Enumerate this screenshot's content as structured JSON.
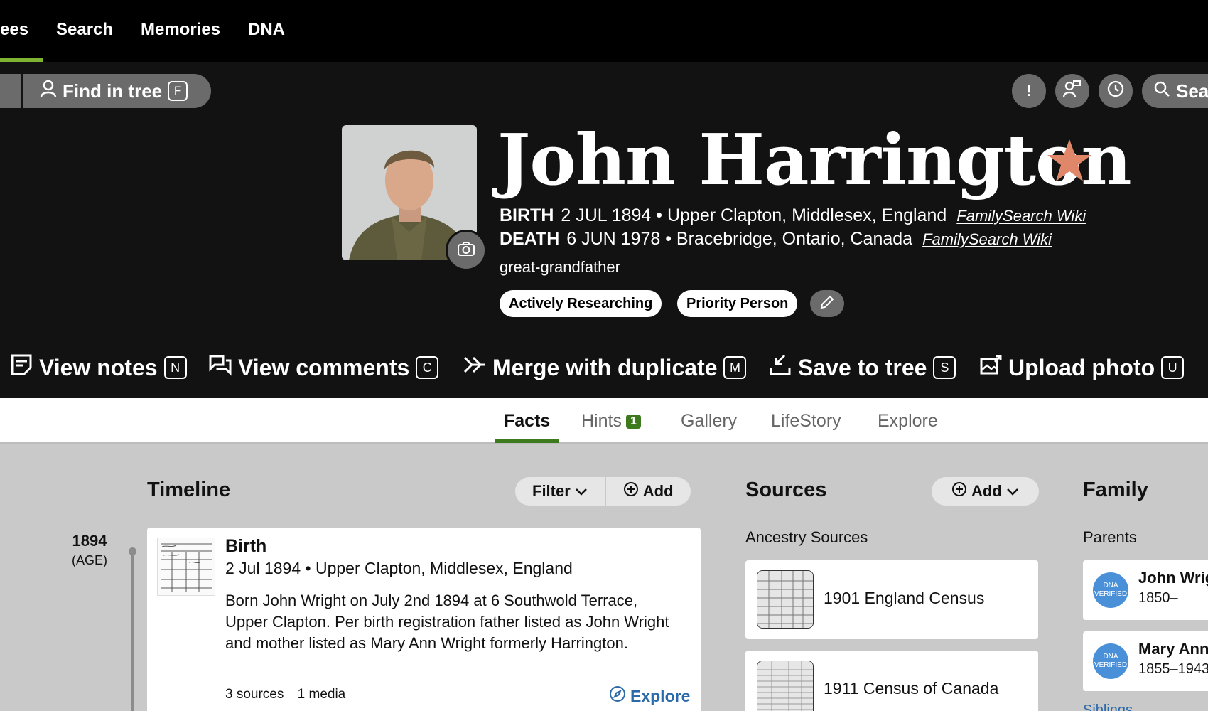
{
  "nav": {
    "items": [
      "ees",
      "Search",
      "Memories",
      "DNA"
    ]
  },
  "toolbar": {
    "find_in_tree": "Find in tree",
    "find_key": "F",
    "alert_icon": "!",
    "search_label": "Sea"
  },
  "person": {
    "name": "John Harrington",
    "birth_label": "BIRTH",
    "birth_value": "2 JUL 1894 • Upper Clapton, Middlesex, England",
    "death_label": "DEATH",
    "death_value": "6 JUN 1978 • Bracebridge, Ontario, Canada",
    "wiki_link": "FamilySearch Wiki",
    "relationship": "great-grandfather",
    "tags": [
      "Actively Researching",
      "Priority Person"
    ]
  },
  "actions": [
    {
      "label": "View notes",
      "key": "N"
    },
    {
      "label": "View comments",
      "key": "C"
    },
    {
      "label": "Merge with duplicate",
      "key": "M"
    },
    {
      "label": "Save to tree",
      "key": "S"
    },
    {
      "label": "Upload photo",
      "key": "U"
    }
  ],
  "tabs": {
    "facts": "Facts",
    "hints": "Hints",
    "hints_count": "1",
    "gallery": "Gallery",
    "lifestory": "LifeStory",
    "explore": "Explore"
  },
  "timeline": {
    "title": "Timeline",
    "filter_label": "Filter",
    "add_label": "Add",
    "year": "1894",
    "age": "(AGE)",
    "event": {
      "title": "Birth",
      "date_place": "2 Jul 1894 • Upper Clapton, Middlesex, England",
      "description": "Born John Wright on July 2nd 1894 at 6 Southwold Terrace, Upper Clapton. Per birth registration father listed as John Wright and mother listed as Mary Ann Wright formerly Harrington.",
      "sources": "3 sources",
      "media": "1 media",
      "explore": "Explore"
    }
  },
  "sources": {
    "title": "Sources",
    "add_label": "Add",
    "subheading": "Ancestry Sources",
    "items": [
      "1901 England Census",
      "1911 Census of Canada"
    ]
  },
  "family": {
    "title": "Family",
    "parents_label": "Parents",
    "dna_badge": "DNA VERIFIED",
    "parents": [
      {
        "name": "John Wrig",
        "dates": "1850–"
      },
      {
        "name": "Mary Ann",
        "dates": "1855–1943"
      }
    ],
    "siblings_label": "Siblings"
  },
  "colors": {
    "nav_active": "#7fb432",
    "tab_active": "#3d7a1d",
    "star": "#e0876a",
    "link": "#2b6aa8",
    "dna": "#4a90d9"
  }
}
